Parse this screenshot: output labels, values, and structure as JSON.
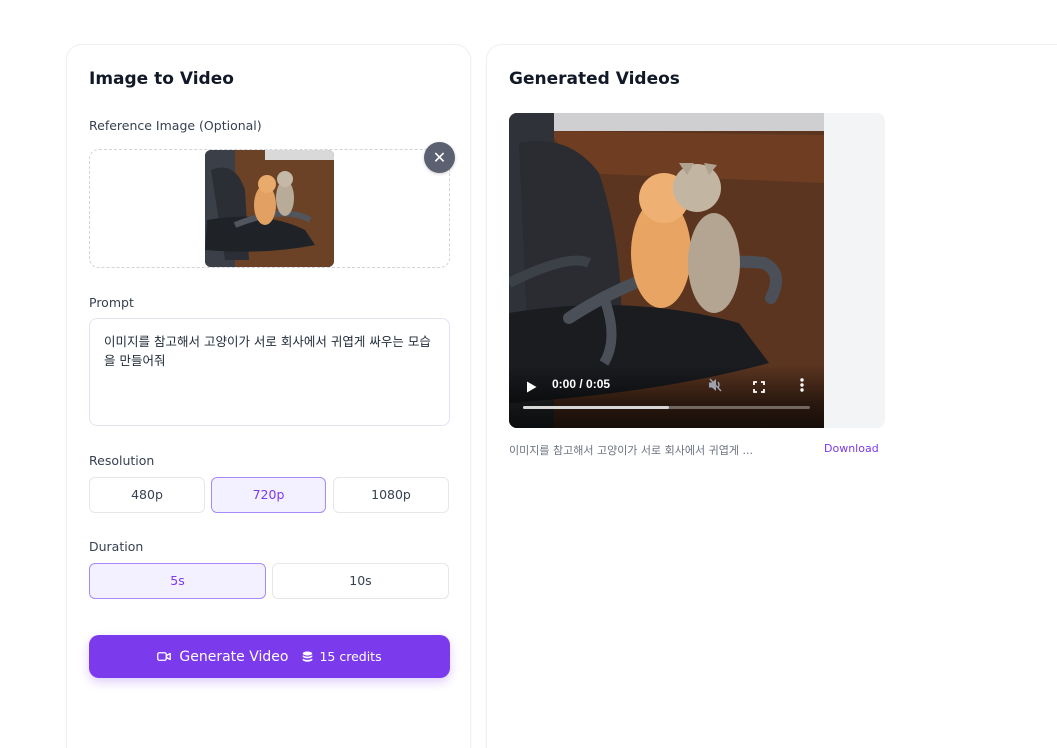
{
  "left_panel": {
    "title": "Image to Video",
    "reference_label": "Reference Image (Optional)",
    "prompt_label": "Prompt",
    "prompt_value": "이미지를 참고해서 고양이가 서로 회사에서 귀엽게 싸우는 모습을 만들어줘",
    "resolution_label": "Resolution",
    "resolution_options": [
      "480p",
      "720p",
      "1080p"
    ],
    "resolution_selected": "720p",
    "duration_label": "Duration",
    "duration_options": [
      "5s",
      "10s"
    ],
    "duration_selected": "5s",
    "generate_label": "Generate Video",
    "credits_label": "15 credits"
  },
  "right_panel": {
    "title": "Generated Videos",
    "videos": [
      {
        "time_display": "0:00 / 0:05",
        "progress": 0.51,
        "caption": "이미지를 참고해서 고양이가 서로 회사에서 귀엽게 ...",
        "download_label": "Download"
      }
    ]
  },
  "icons": {
    "close": "close-icon",
    "video_camera": "video-camera-icon",
    "coins": "coin-stack-icon",
    "play": "play-icon",
    "volume": "volume-icon",
    "fullscreen": "fullscreen-icon",
    "more": "more-vertical-icon"
  },
  "colors": {
    "accent": "#7c3aed",
    "selected_bg": "#f3f0ff",
    "selected_border": "#a78bfa"
  }
}
